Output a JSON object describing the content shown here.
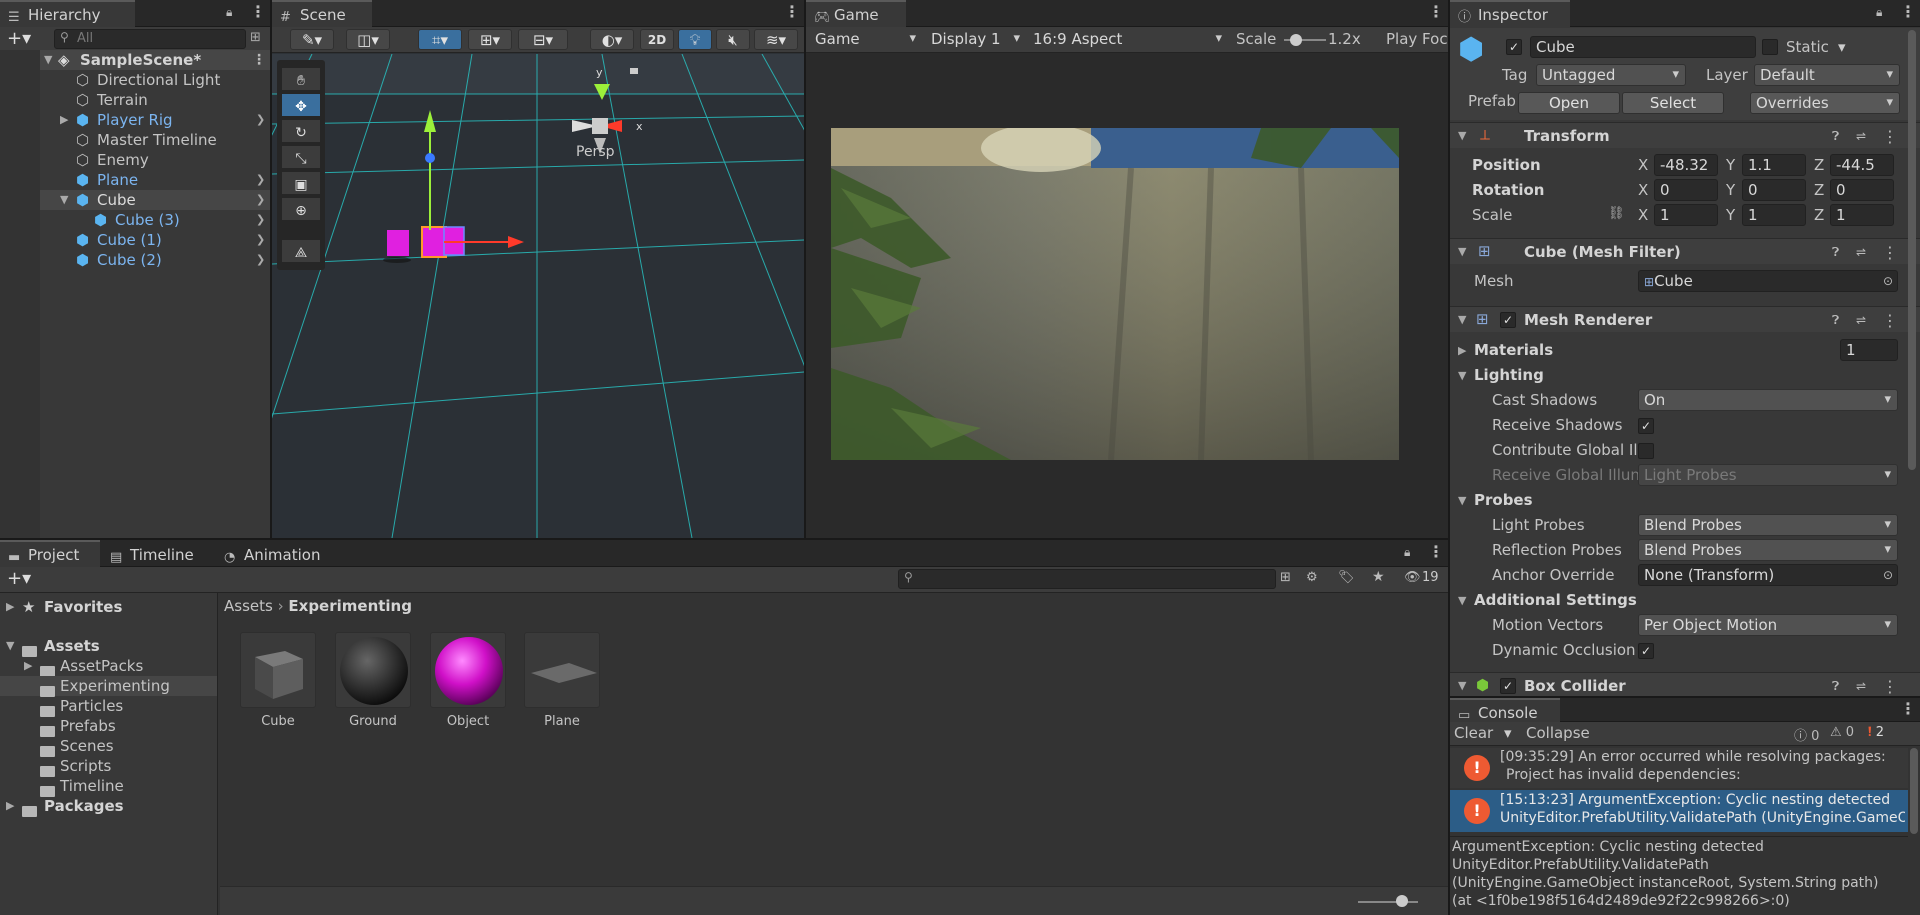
{
  "hierarchy": {
    "tab": "Hierarchy",
    "search_placeholder": "All",
    "scene": "SampleScene*",
    "items": [
      {
        "label": "Directional Light",
        "prefab": false
      },
      {
        "label": "Terrain",
        "prefab": false
      },
      {
        "label": "Player Rig",
        "prefab": true
      },
      {
        "label": "Master Timeline",
        "prefab": false
      },
      {
        "label": "Enemy",
        "prefab": false
      },
      {
        "label": "Plane",
        "prefab": true
      },
      {
        "label": "Cube",
        "prefab": true
      },
      {
        "label": "Cube (3)",
        "prefab": true
      },
      {
        "label": "Cube (1)",
        "prefab": true
      },
      {
        "label": "Cube (2)",
        "prefab": true
      }
    ]
  },
  "scene": {
    "tab": "Scene",
    "btn_2d": "2D",
    "persp": "Persp",
    "axis_x": "x",
    "axis_y": "y"
  },
  "game": {
    "tab": "Game",
    "mode": "Game",
    "display": "Display 1",
    "aspect": "16:9 Aspect",
    "scale_label": "Scale",
    "scale_value": "1.2x",
    "play_focus": "Play Foc"
  },
  "inspector": {
    "tab": "Inspector",
    "object_name": "Cube",
    "static": "Static",
    "tag_label": "Tag",
    "tag": "Untagged",
    "layer_label": "Layer",
    "layer": "Default",
    "prefab_label": "Prefab",
    "open": "Open",
    "select": "Select",
    "overrides": "Overrides",
    "transform": {
      "title": "Transform",
      "position": "Position",
      "rotation": "Rotation",
      "scale": "Scale",
      "pos": [
        "-48.32",
        "1.1",
        "-44.5"
      ],
      "rot": [
        "0",
        "0",
        "0"
      ],
      "scl": [
        "1",
        "1",
        "1"
      ],
      "x": "X",
      "y": "Y",
      "z": "Z"
    },
    "mesh_filter": {
      "title": "Cube (Mesh Filter)",
      "mesh_label": "Mesh",
      "mesh": "Cube"
    },
    "mesh_renderer": {
      "title": "Mesh Renderer",
      "materials": "Materials",
      "materials_count": "1",
      "lighting": "Lighting",
      "cast_shadows": "Cast Shadows",
      "cast_shadows_value": "On",
      "receive_shadows": "Receive Shadows",
      "contribute_gi": "Contribute Global Ill",
      "receive_gi": "Receive Global Illun",
      "receive_gi_value": "Light Probes",
      "probes": "Probes",
      "light_probes": "Light Probes",
      "light_probes_value": "Blend Probes",
      "reflection_probes": "Reflection Probes",
      "reflection_probes_value": "Blend Probes",
      "anchor_override": "Anchor Override",
      "anchor_value": "None (Transform)",
      "additional": "Additional Settings",
      "motion_vectors": "Motion Vectors",
      "motion_vectors_value": "Per Object Motion",
      "dynamic_occlusion": "Dynamic Occlusion"
    },
    "box_collider": "Box Collider"
  },
  "project": {
    "tab": "Project",
    "timeline_tab": "Timeline",
    "animation_tab": "Animation",
    "hidden_count": "19",
    "favorites": "Favorites",
    "assets": "Assets",
    "folders": [
      "AssetPacks",
      "Experimenting",
      "Particles",
      "Prefabs",
      "Scenes",
      "Scripts",
      "Timeline"
    ],
    "packages": "Packages",
    "breadcrumb_root": "Assets",
    "breadcrumb_current": "Experimenting",
    "files": [
      "Cube",
      "Ground",
      "Object",
      "Plane"
    ]
  },
  "console": {
    "tab": "Console",
    "clear": "Clear",
    "collapse": "Collapse",
    "count_log": "0",
    "count_warn": "0",
    "count_err": "2",
    "entries": [
      {
        "line1": "[09:35:29] An error occurred while resolving packages:",
        "line2": "Project has invalid dependencies:"
      },
      {
        "line1": "[15:13:23] ArgumentException: Cyclic nesting detected",
        "line2": "UnityEditor.PrefabUtility.ValidatePath (UnityEngine.GameO"
      }
    ],
    "detail": [
      "ArgumentException: Cyclic nesting detected",
      "UnityEditor.PrefabUtility.ValidatePath",
      "(UnityEngine.GameObject instanceRoot, System.String path)",
      "(at <1f0be198f5164d2489de92f22c998266>:0)"
    ]
  },
  "colors": {
    "selection": "#2c5d87",
    "prefab_text": "#7cb5f0",
    "error": "#ee5a32",
    "grid": "#28c8c8",
    "magenta": "#e020e0"
  }
}
